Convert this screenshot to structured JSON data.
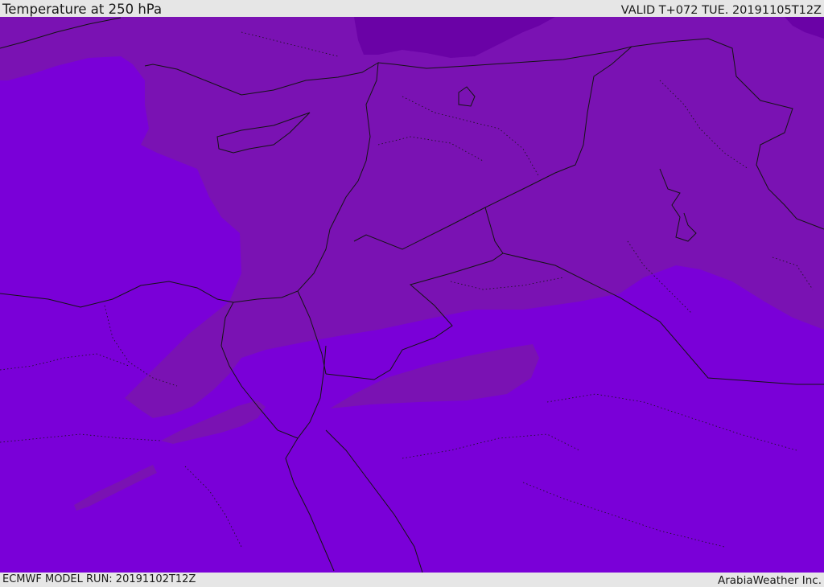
{
  "header": {
    "title": "Temperature at 250 hPa",
    "valid_time": "VALID T+072 TUE. 20191105T12Z"
  },
  "footer": {
    "model_run": "ECMWF MODEL RUN: 20191102T12Z",
    "credit": "ArabiaWeather Inc."
  },
  "colors": {
    "background_field": "#7a00d8",
    "warm_band": "#7a12b3",
    "coldest_band": "#6a02a6",
    "border_line": "#141414"
  }
}
